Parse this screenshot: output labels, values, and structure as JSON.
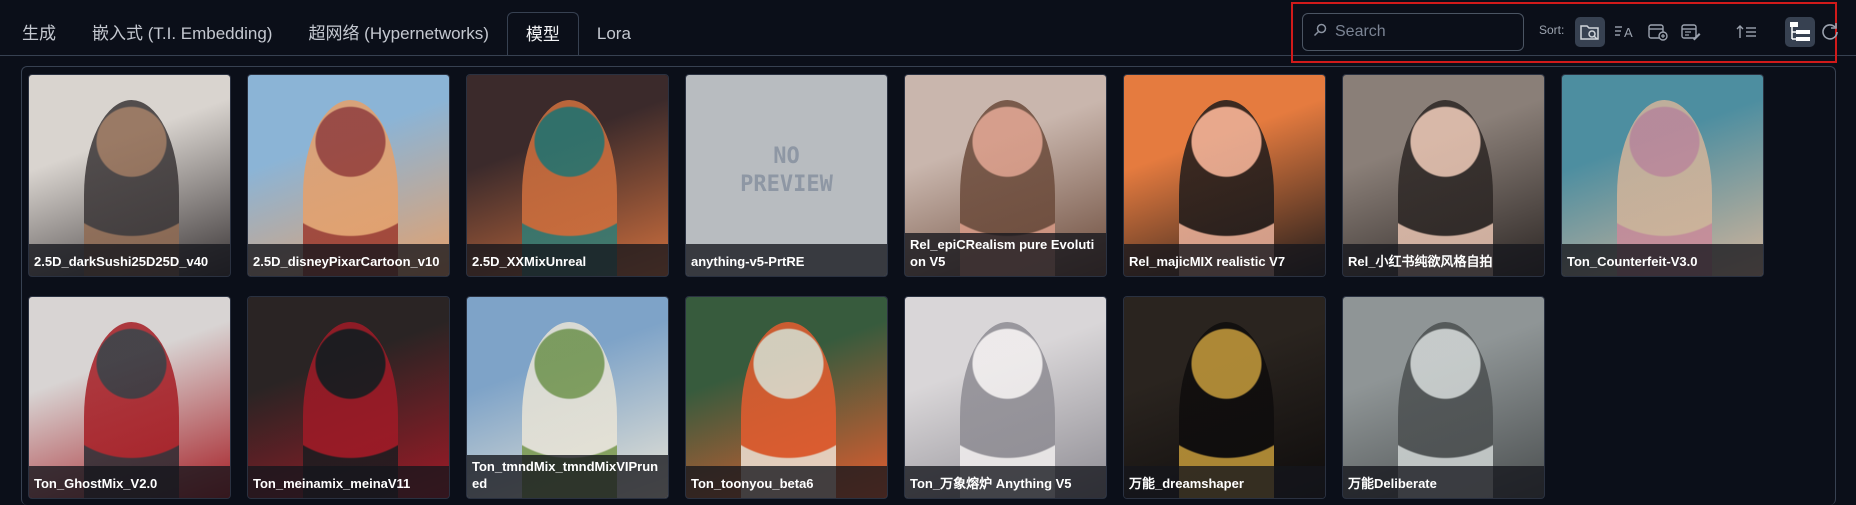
{
  "tabs": [
    {
      "label": "生成",
      "active": false
    },
    {
      "label": "嵌入式 (T.I. Embedding)",
      "active": false
    },
    {
      "label": "超网络 (Hypernetworks)",
      "active": false
    },
    {
      "label": "模型",
      "active": true
    },
    {
      "label": "Lora",
      "active": false
    }
  ],
  "search": {
    "placeholder": "Search",
    "value": ""
  },
  "sort": {
    "label": "Sort:"
  },
  "toolbar_icons": [
    "search-folder-icon",
    "sort-by-name-icon",
    "sort-by-date-created-icon",
    "sort-by-date-modified-icon",
    "sort-direction-icon",
    "tree-view-icon",
    "refresh-icon"
  ],
  "models": [
    {
      "name": "2.5D_darkSushi25D25D_v40",
      "palette": [
        "#d9d4cf",
        "#3a3536",
        "#8f6a52"
      ]
    },
    {
      "name": "2.5D_disneyPixarCartoon_v10",
      "palette": [
        "#8bb4d6",
        "#e6a06a",
        "#9c3a2e"
      ]
    },
    {
      "name": "2.5D_XXMixUnreal",
      "palette": [
        "#3b2a2b",
        "#d0703e",
        "#2f7c75"
      ]
    },
    {
      "name": "anything-v5-PrtRE",
      "palette": [
        "#b8bcc0",
        "#b8bcc0",
        "#8e97a4"
      ],
      "no_preview": true,
      "preview_text": "NO\nPREVIEW"
    },
    {
      "name": "Rel_epiCRealism pure Evolution V5",
      "palette": [
        "#c9b6ad",
        "#6b4a3a",
        "#d89a86"
      ]
    },
    {
      "name": "Rel_majicMIX realistic V7",
      "palette": [
        "#e57b3f",
        "#1f1b1b",
        "#e8b09a"
      ]
    },
    {
      "name": "Rel_小红书纯欲风格自拍",
      "palette": [
        "#8a7f78",
        "#2c2624",
        "#e6c2b0"
      ]
    },
    {
      "name": "Ton_Counterfeit-V3.0",
      "palette": [
        "#4d8ea0",
        "#d3b49a",
        "#c98a9a"
      ]
    },
    {
      "name": "Ton_GhostMix_V2.0",
      "palette": [
        "#d8d4d3",
        "#a51d24",
        "#2d2a31"
      ]
    },
    {
      "name": "Ton_meinamix_meinaV11",
      "palette": [
        "#2a2424",
        "#a01a26",
        "#1b1b1f"
      ]
    },
    {
      "name": "Ton_tmndMix_tmndMixVIPruned",
      "palette": [
        "#7ea3c8",
        "#e9e4d6",
        "#7b9a4d"
      ]
    },
    {
      "name": "Ton_toonyou_beta6",
      "palette": [
        "#375b3d",
        "#e55c2f",
        "#eee1d3"
      ]
    },
    {
      "name": "Ton_万象熔炉 Anything V5",
      "palette": [
        "#d9d6d8",
        "#8e8c93",
        "#f1eeee"
      ]
    },
    {
      "name": "万能_dreamshaper",
      "palette": [
        "#2a241f",
        "#0e0c0c",
        "#c49a3a"
      ]
    },
    {
      "name": "万能Deliberate",
      "palette": [
        "#8f9596",
        "#4b4f50",
        "#cfd4d3"
      ]
    }
  ]
}
